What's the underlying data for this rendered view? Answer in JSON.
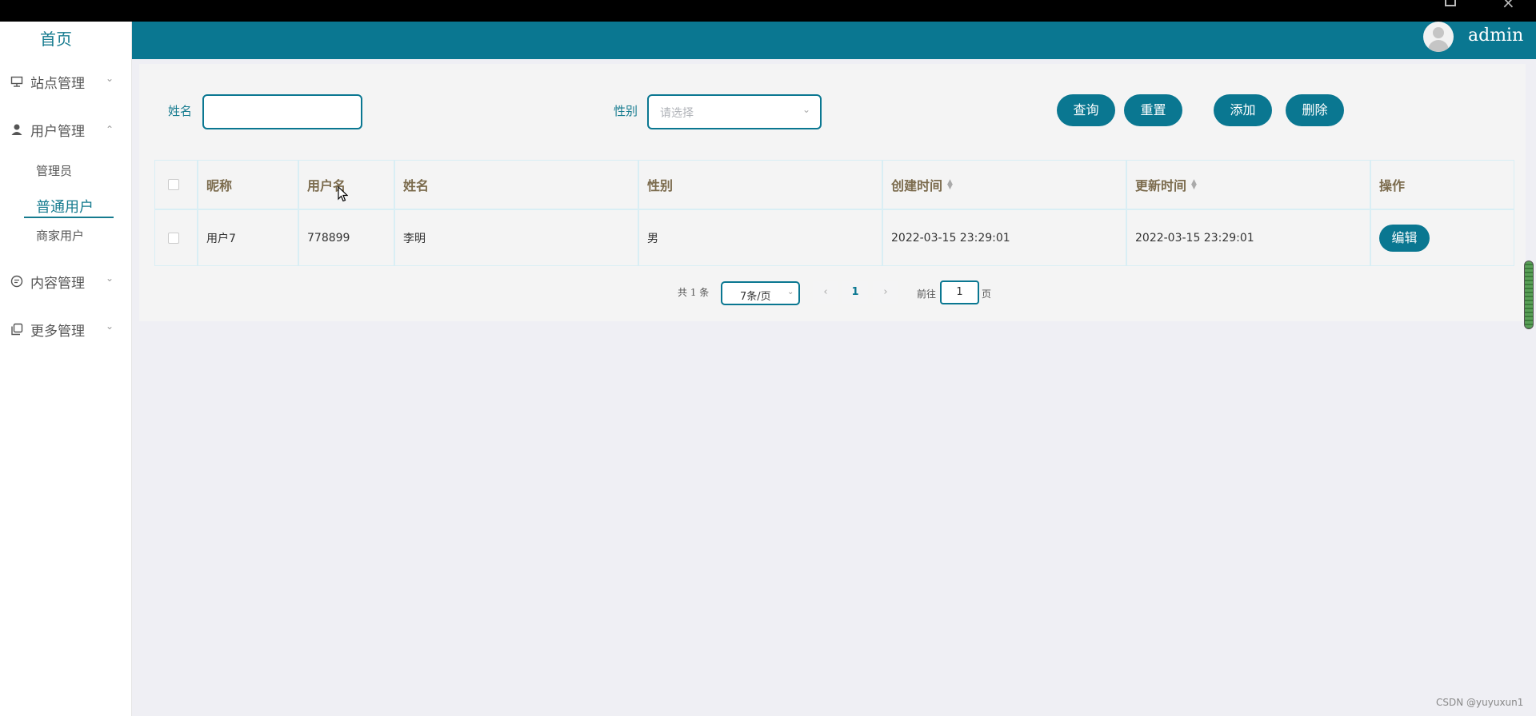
{
  "window": {
    "restore_icon": "restore-icon",
    "close_icon": "close-icon"
  },
  "sidebar": {
    "home": "首页",
    "menus": [
      {
        "label": "站点管理",
        "icon": "monitor-icon"
      },
      {
        "label": "用户管理",
        "icon": "user-icon"
      },
      {
        "label": "内容管理",
        "icon": "chat-icon"
      },
      {
        "label": "更多管理",
        "icon": "copy-icon"
      }
    ],
    "user_sub": [
      "管理员",
      "普通用户",
      "商家用户"
    ]
  },
  "header": {
    "username": "admin"
  },
  "search": {
    "name_label": "姓名",
    "name_value": "",
    "sex_label": "性别",
    "sex_placeholder": "请选择",
    "buttons": {
      "query": "查询",
      "reset": "重置",
      "add": "添加",
      "delete": "删除"
    }
  },
  "table": {
    "columns": [
      "昵称",
      "用户名",
      "姓名",
      "性别",
      "创建时间",
      "更新时间",
      "操作"
    ],
    "rows": [
      {
        "nickname": "用户7",
        "username": "778899",
        "name": "李明",
        "sex": "男",
        "created": "2022-03-15 23:29:01",
        "updated": "2022-03-15 23:29:01",
        "action": "编辑"
      }
    ]
  },
  "pager": {
    "total": "共 1 条",
    "page_size": "7条/页",
    "prev": "‹",
    "current": "1",
    "next": "›",
    "goto_prefix": "前往",
    "goto_value": "1",
    "goto_suffix": "页"
  },
  "watermark": "CSDN @yuyuxun1"
}
